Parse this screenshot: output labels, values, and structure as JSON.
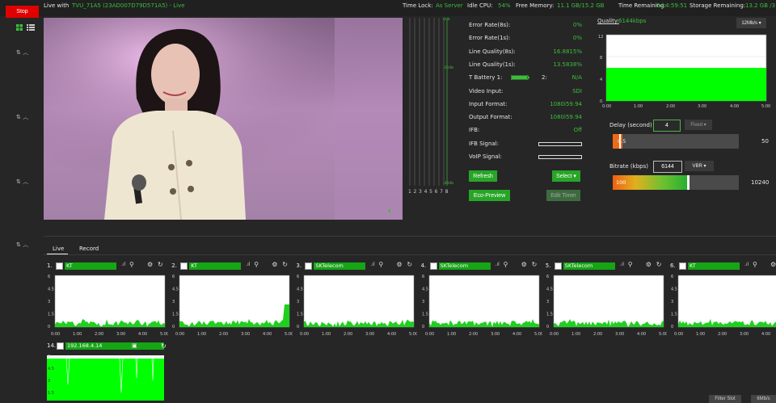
{
  "top": {
    "stop_label": "Stop",
    "live_with_label": "Live with",
    "live_with_value": "TVU_71A5 (23AD007D79D571A5) - Live",
    "time_lock_label": "Time Lock:",
    "time_lock_value": "As Server",
    "idle_cpu_label": "Idle CPU:",
    "idle_cpu_value": "54%",
    "free_memory_label": "Free Memory:",
    "free_memory_value": "11.1 GB/15.2 GB",
    "time_remaining_label": "Time Remaining:",
    "time_remaining_value": "0d 4:59:51",
    "storage_label": "Storage Remaining:",
    "storage_value": "13.2 GB /3"
  },
  "meters": {
    "scale": [
      "0db",
      "-20db",
      "-40db"
    ],
    "channels": "1 2 3 4 5 6 7 8"
  },
  "stats": [
    {
      "label": "Error Rate(8s):",
      "value": "0%"
    },
    {
      "label": "Error Rate(1s):",
      "value": "0%"
    },
    {
      "label": "Line Quality(8s):",
      "value": "16.8815%"
    },
    {
      "label": "Line Quality(1s):",
      "value": "13.5838%"
    },
    {
      "label": "T Battery 1:",
      "value": "N/A",
      "extra": "2:"
    },
    {
      "label": "Video Input:",
      "value": "SDI"
    },
    {
      "label": "Input Format:",
      "value": "1080i59.94"
    },
    {
      "label": "Output Format:",
      "value": "1080i59.94"
    },
    {
      "label": "IFB:",
      "value": "Off"
    },
    {
      "label": "IFB Signal:",
      "value": ""
    },
    {
      "label": "VoIP Signal:",
      "value": ""
    }
  ],
  "buttons": {
    "refresh": "Refresh",
    "select": "Select ▾",
    "eco_preview": "Eco-Preview",
    "edit_timer": "Edit Timer"
  },
  "quality": {
    "label": "Quality:",
    "value": "6144kbps",
    "dropdown": "12Mb/s ▾",
    "y_ticks": [
      "12",
      "8",
      "4",
      "0"
    ],
    "x_ticks": [
      "0:00",
      "1:00",
      "2:00",
      "3:00",
      "4:00",
      "5:00"
    ]
  },
  "delay": {
    "label": "Delay (second)",
    "value": "4",
    "mode": "Fixed ▾",
    "slider_value": "0.5",
    "max": "50"
  },
  "bitrate": {
    "label": "Bitrate (kbps)",
    "value": "6144",
    "mode": "VBR ▾",
    "min": "100",
    "max": "10240",
    "level": 0.6
  },
  "tabs": [
    "Live",
    "Record"
  ],
  "slots": [
    {
      "num": "1.",
      "carrier": "KT"
    },
    {
      "num": "2.",
      "carrier": "KT"
    },
    {
      "num": "3.",
      "carrier": "SKTelecom"
    },
    {
      "num": "4.",
      "carrier": "SKTelecom"
    },
    {
      "num": "5.",
      "carrier": "SKTelecom"
    },
    {
      "num": "6.",
      "carrier": "KT"
    }
  ],
  "slot_y_ticks": [
    "6",
    "4.5",
    "3",
    "1.5",
    "0"
  ],
  "slot_x_ticks": [
    "0:00",
    "1:00",
    "2:00",
    "3:00",
    "4:00",
    "5:00"
  ],
  "slot14": {
    "num": "14.",
    "carrier": "192.168.4.14",
    "y_ticks": [
      "6",
      "4.5",
      "3",
      "1.5"
    ]
  },
  "footer": {
    "filter_slot": "Filter Slot",
    "rate": "6Mb/s"
  },
  "colors": {
    "accent": "#3dbd3d",
    "stop": "#e00000",
    "chart_fill": "#00ff00"
  }
}
